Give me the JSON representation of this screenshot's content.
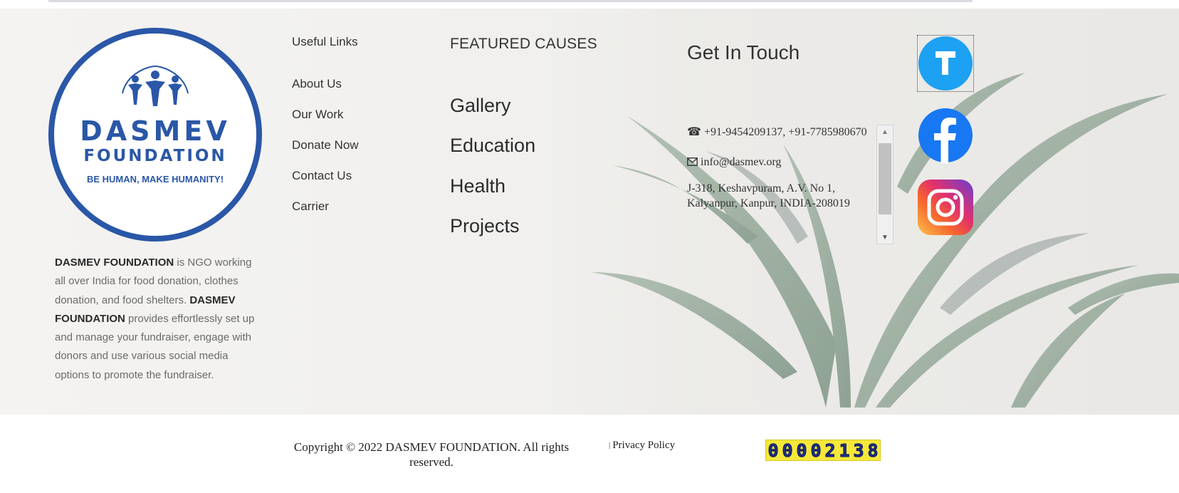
{
  "logo": {
    "name_line1": "DASMEV",
    "name_line2": "FOUNDATION",
    "tagline": "BE HUMAN, MAKE HUMANITY!",
    "brand_color": "#2a57a7"
  },
  "about": {
    "brand1": "DASMEV FOUNDATION",
    "text1": " is NGO working all over India for food donation, clothes donation, and food shelters. ",
    "brand2": "DASMEV FOUNDATION",
    "text2": " provides effortlessly set up and manage your fundraiser, engage with donors and use various social media options to promote the fundraiser."
  },
  "useful_links": {
    "title": "Useful Links",
    "items": [
      "About Us",
      "Our Work",
      "Donate Now",
      "Contact Us",
      "Carrier"
    ]
  },
  "featured_causes": {
    "title": "FEATURED CAUSES",
    "items": [
      "Gallery",
      "Education",
      "Health",
      "Projects"
    ]
  },
  "contact": {
    "title": "Get In Touch",
    "phone_icon": "☎",
    "phone": "+91-9454209137, +91-7785980670",
    "email_icon": "envelope-icon",
    "email": "info@dasmev.org",
    "address_icon": "",
    "address": "J-318, Keshavpuram, A.V. No 1, Kalyanpur, Kanpur, INDIA-208019"
  },
  "social": {
    "twitter": {
      "icon": "twitter-icon",
      "color": "#1da1f2"
    },
    "facebook": {
      "icon": "facebook-icon",
      "color": "#1877f2"
    },
    "instagram": {
      "icon": "instagram-icon"
    }
  },
  "bottom": {
    "copyright": "Copyright © 2022 DASMEV FOUNDATION. All rights reserved.",
    "privacy": "Privacy Policy",
    "visitor_counter": [
      "0",
      "0",
      "0",
      "0",
      "2",
      "1",
      "3",
      "8"
    ]
  }
}
